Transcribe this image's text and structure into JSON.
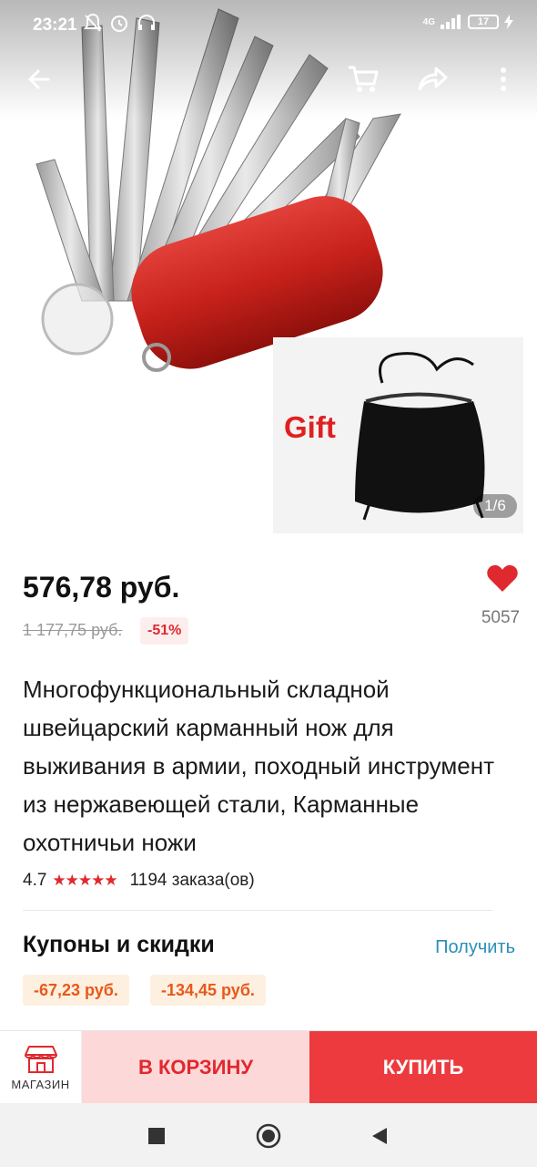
{
  "status_bar": {
    "time": "23:21",
    "network": "4G",
    "battery": "17"
  },
  "top_bar": {
    "icons": [
      "back-arrow-icon",
      "cart-icon",
      "share-icon",
      "more-vertical-icon"
    ]
  },
  "gallery": {
    "gift_label": "Gift",
    "counter": "1/6"
  },
  "price": {
    "current": "576,78 руб.",
    "old": "1 177,75 руб.",
    "discount": "-51%"
  },
  "favorites": {
    "count": "5057",
    "color": "#e0292f"
  },
  "product": {
    "title": "Многофункциональный складной швейцарский карманный нож для выживания в армии, походный инструмент из нержавеющей стали, Карманные охотничьи ножи",
    "rating": "4.7",
    "rating_stars": 4.7,
    "stars": "★★★★★",
    "orders": "1194 заказа(ов)"
  },
  "coupons": {
    "title": "Купоны и скидки",
    "action": "Получить",
    "items": [
      "-67,23 руб.",
      "-134,45 руб."
    ]
  },
  "action_bar": {
    "store_label": "МАГАЗИН",
    "cart_label": "В КОРЗИНУ",
    "buy_label": "КУПИТЬ",
    "accent": "#ec3a3e"
  },
  "nav_bar": {
    "icons": [
      "recent-apps-icon",
      "home-icon",
      "back-icon"
    ]
  }
}
